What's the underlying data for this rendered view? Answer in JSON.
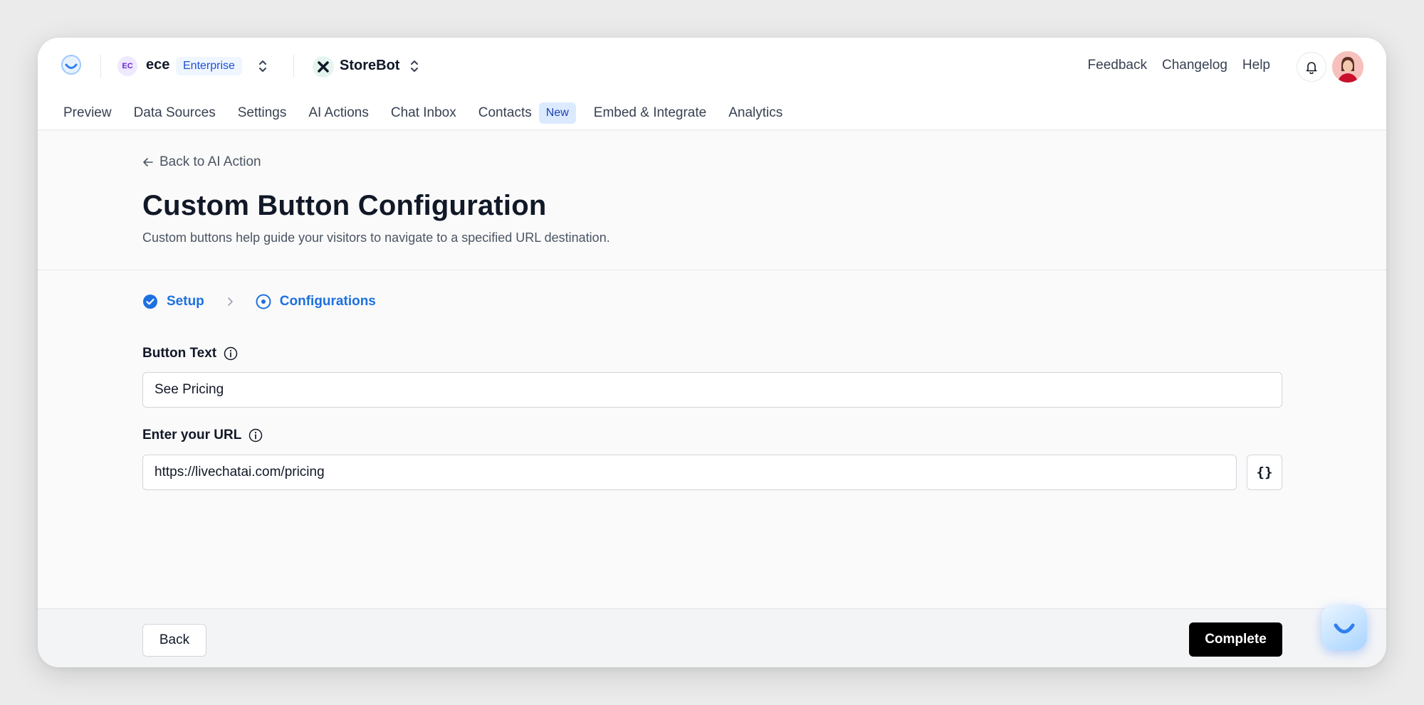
{
  "header": {
    "org": {
      "initials": "EC",
      "name": "ece",
      "plan": "Enterprise"
    },
    "bot": {
      "name": "StoreBot"
    },
    "links": [
      "Feedback",
      "Changelog",
      "Help"
    ]
  },
  "nav": {
    "items": [
      {
        "label": "Preview"
      },
      {
        "label": "Data Sources"
      },
      {
        "label": "Settings"
      },
      {
        "label": "AI Actions"
      },
      {
        "label": "Chat Inbox"
      },
      {
        "label": "Contacts",
        "badge": "New"
      },
      {
        "label": "Embed & Integrate"
      },
      {
        "label": "Analytics"
      }
    ]
  },
  "page": {
    "back_label": "Back to AI Action",
    "title": "Custom Button Configuration",
    "subtitle": "Custom buttons help guide your visitors to navigate to a specified URL destination."
  },
  "steps": [
    {
      "label": "Setup",
      "state": "complete"
    },
    {
      "label": "Configurations",
      "state": "current"
    }
  ],
  "form": {
    "button_text": {
      "label": "Button Text",
      "value": "See Pricing"
    },
    "url": {
      "label": "Enter your URL",
      "value": "https://livechatai.com/pricing",
      "variable_button": "{}"
    }
  },
  "footer": {
    "back_label": "Back",
    "complete_label": "Complete"
  },
  "colors": {
    "accent": "#1d70e0",
    "primary_button": "#000000",
    "badge_bg": "#dbeafe"
  }
}
